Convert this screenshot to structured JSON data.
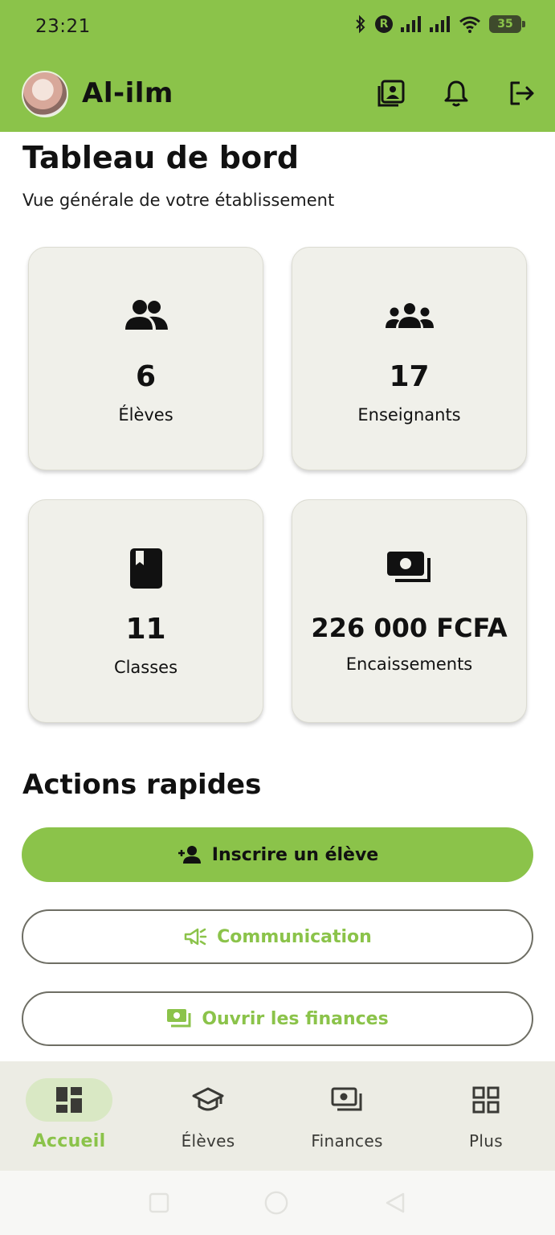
{
  "status_bar": {
    "time": "23:21",
    "battery": "35",
    "icons": [
      "bluetooth-icon",
      "r-badge-icon",
      "signal-icon",
      "signal-icon",
      "wifi-icon",
      "battery-icon"
    ],
    "r_badge": "R"
  },
  "app_bar": {
    "title": "Al-ilm",
    "actions": [
      "id-card-icon",
      "bell-icon",
      "logout-icon"
    ]
  },
  "dashboard": {
    "title": "Tableau de bord",
    "subtitle": "Vue générale de votre établissement"
  },
  "stats": [
    {
      "icon": "students-icon",
      "value": "6",
      "label": "Élèves"
    },
    {
      "icon": "teachers-icon",
      "value": "17",
      "label": "Enseignants"
    },
    {
      "icon": "book-icon",
      "value": "11",
      "label": "Classes"
    },
    {
      "icon": "money-icon",
      "value": "226 000 FCFA",
      "label": "Encaissements"
    }
  ],
  "quick_actions": {
    "title": "Actions rapides",
    "enroll_label": "Inscrire un élève",
    "communication_label": "Communication",
    "finances_label": "Ouvrir les finances"
  },
  "bottom_nav": {
    "items": [
      {
        "icon": "dashboard-icon",
        "label": "Accueil",
        "active": true
      },
      {
        "icon": "graduation-cap-icon",
        "label": "Élèves",
        "active": false
      },
      {
        "icon": "money-icon",
        "label": "Finances",
        "active": false
      },
      {
        "icon": "grid-icon",
        "label": "Plus",
        "active": false
      }
    ]
  },
  "colors": {
    "brand_green": "#8bc34a",
    "card_bg": "#f0f0ea",
    "nav_bg": "#ecece4",
    "active_pill": "#d9e8c4"
  }
}
